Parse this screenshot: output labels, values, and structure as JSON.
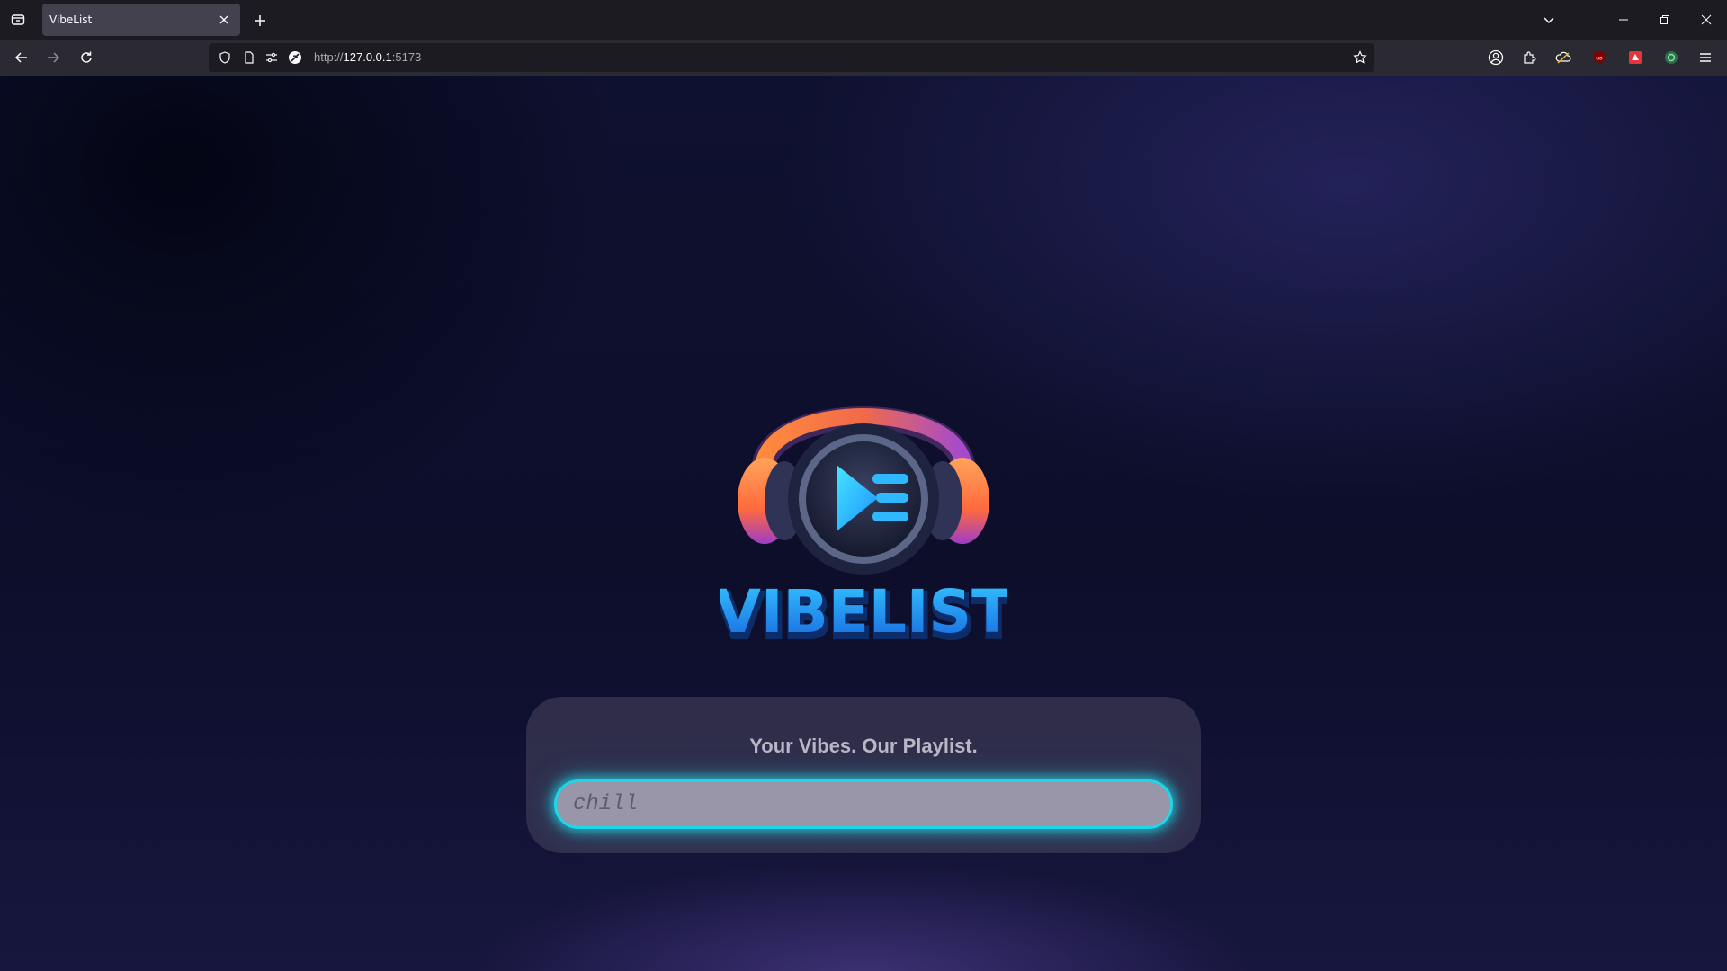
{
  "browser": {
    "tab": {
      "title": "VibeList",
      "close_icon": "close-icon"
    },
    "url": {
      "scheme": "http://",
      "host": "127.0.0.1",
      "port": ":5173"
    },
    "icons": {
      "tab_list": "tab-list-icon",
      "new_tab": "plus-icon",
      "overflow": "chevron-down-icon",
      "back": "arrow-left-icon",
      "forward": "arrow-right-icon",
      "reload": "reload-icon",
      "shield": "shield-icon",
      "page": "page-icon",
      "permissions": "permissions-icon",
      "insecure": "insecure-connection-icon",
      "bookmark": "star-icon",
      "account": "account-icon",
      "extensions": "extensions-icon",
      "menu": "hamburger-menu-icon"
    }
  },
  "app": {
    "brand": "VIBELIST",
    "tagline": "Your Vibes. Our Playlist.",
    "search": {
      "placeholder": "chill",
      "value": ""
    },
    "colors": {
      "accent": "#1fd6e6",
      "brand_blue": "#1aa3ff",
      "headphone_orange": "#ff7a3d",
      "headphone_purple": "#8a3fc7"
    }
  }
}
